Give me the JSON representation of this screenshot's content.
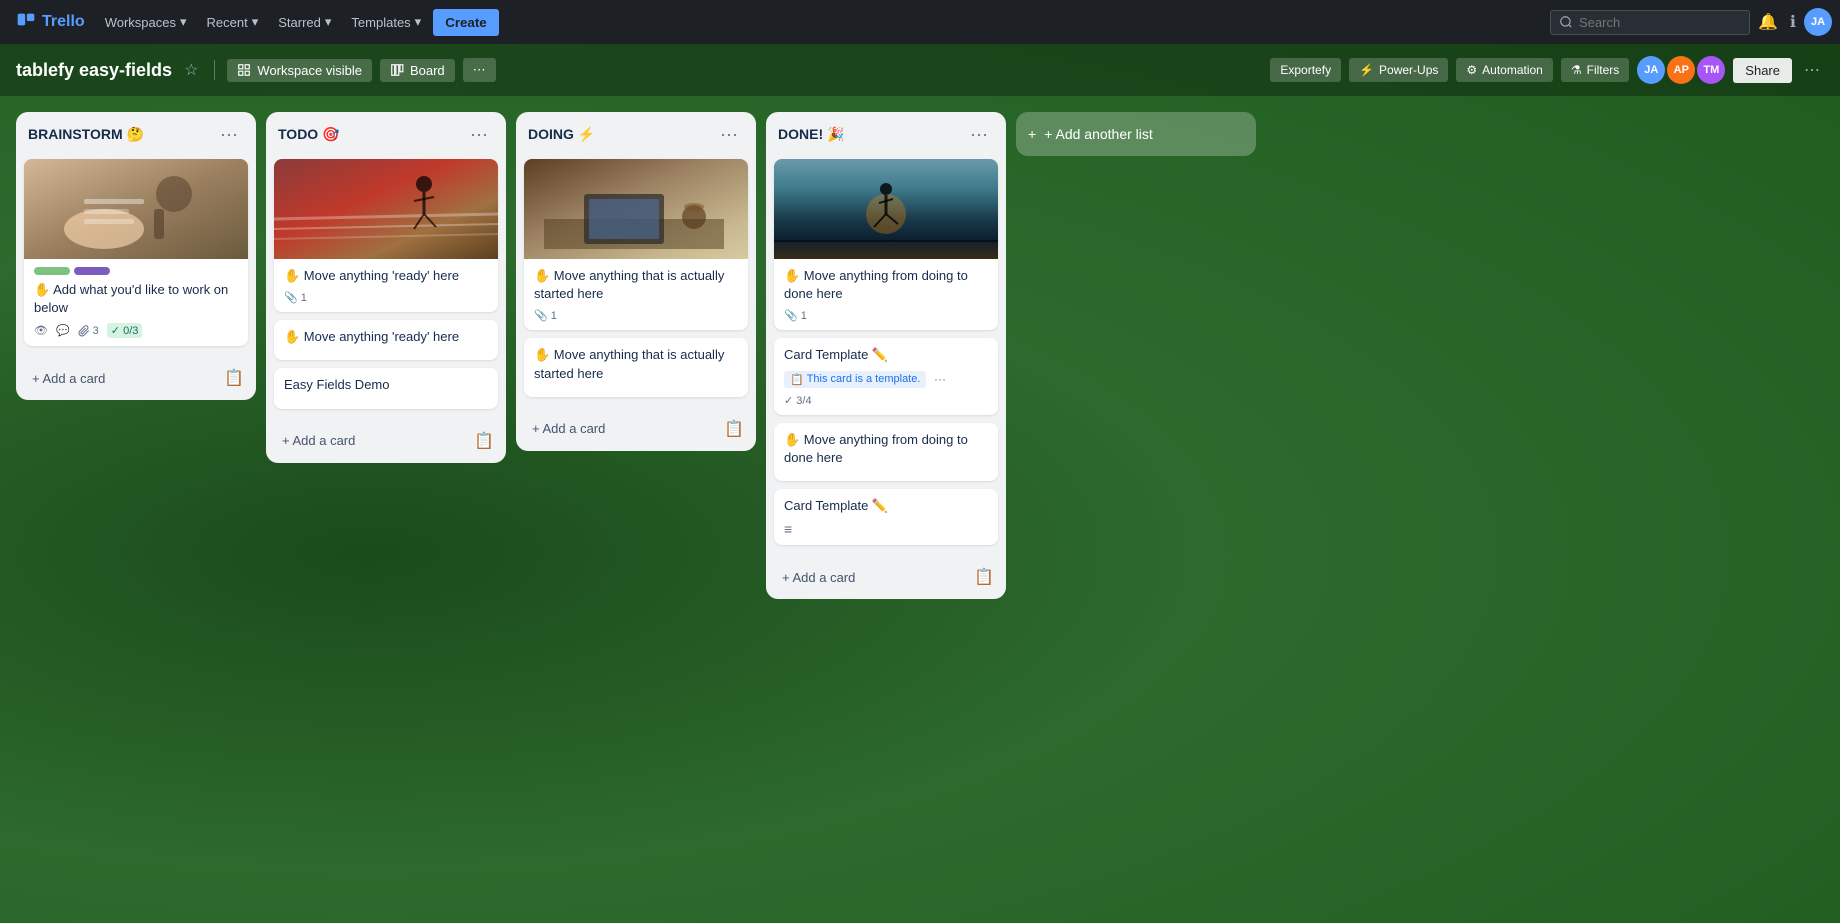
{
  "app": {
    "logo_text": "Trello"
  },
  "topnav": {
    "workspaces_label": "Workspaces",
    "recent_label": "Recent",
    "starred_label": "Starred",
    "templates_label": "Templates",
    "create_label": "Create",
    "search_placeholder": "Search",
    "chevron": "▾"
  },
  "boardheader": {
    "title": "tablefy easy-fields",
    "star_symbol": "☆",
    "workspace_visible_label": "Workspace visible",
    "board_label": "Board",
    "customize_symbol": "⋯",
    "exportefy_label": "Exportefy",
    "powerups_label": "Power-Ups",
    "automation_label": "Automation",
    "filters_label": "Filters",
    "share_label": "Share"
  },
  "lists": [
    {
      "id": "brainstorm",
      "title": "BRAINSTORM 🤔",
      "cards": [
        {
          "id": "b1",
          "has_image": true,
          "image_desc": "hands writing on paper",
          "image_gradient": "linear-gradient(135deg, #c4a882 0%, #8b7355 50%, #6b5a3e 100%)",
          "labels": [
            {
              "color": "#7bc47f",
              "width": 36
            },
            {
              "color": "#7c5cbf",
              "width": 36
            }
          ],
          "text": "✋ Add what you'd like to work on below",
          "badges": [
            {
              "type": "watch",
              "symbol": "👁",
              "count": ""
            },
            {
              "type": "comment",
              "symbol": "💬",
              "count": ""
            },
            {
              "type": "attach",
              "symbol": "📎",
              "count": "3"
            },
            {
              "type": "checklist",
              "symbol": "✓",
              "count": "0/3",
              "highlight": true
            }
          ]
        }
      ],
      "add_card_label": "+ Add a card"
    },
    {
      "id": "todo",
      "title": "TODO 🎯",
      "cards": [
        {
          "id": "t1",
          "has_image": true,
          "image_desc": "running on track",
          "image_gradient": "linear-gradient(135deg, #8b3a3a 0%, #c0392b 30%, #8b5a2b 60%, #5a4020 100%)",
          "text": "✋ Move anything 'ready' here",
          "badges": [
            {
              "type": "attach",
              "symbol": "📎",
              "count": "1"
            }
          ]
        },
        {
          "id": "t2",
          "text": "✋ Move anything 'ready' here",
          "badges": []
        },
        {
          "id": "t3",
          "text": "Easy Fields Demo",
          "badges": []
        }
      ],
      "add_card_label": "+ Add a card"
    },
    {
      "id": "doing",
      "title": "DOING ⚡",
      "cards": [
        {
          "id": "d1",
          "has_image": true,
          "image_desc": "laptop on desk with coffee",
          "image_gradient": "linear-gradient(135deg, #4a3728 0%, #7a6550 30%, #b8a882 60%, #d4c4a0 100%)",
          "text": "✋ Move anything that is actually started here",
          "badges": [
            {
              "type": "attach",
              "symbol": "📎",
              "count": "1"
            }
          ]
        },
        {
          "id": "d2",
          "text": "✋ Move anything that is actually started here",
          "badges": []
        }
      ],
      "add_card_label": "+ Add a card"
    },
    {
      "id": "done",
      "title": "DONE! 🎉",
      "cards": [
        {
          "id": "dn1",
          "has_image": true,
          "image_desc": "person jumping at sunset",
          "image_gradient": "linear-gradient(180deg, #4a7a8a 0%, #2d5a6e 30%, #1a3a4a 60%, #0d1f2a 80%, #3a2a1a 100%)",
          "text": "✋ Move anything from doing to done here",
          "badges": [
            {
              "type": "attach",
              "symbol": "📎",
              "count": "1"
            }
          ]
        },
        {
          "id": "dn2",
          "text": "Card Template ✏️",
          "is_template": true,
          "template_badge": "This card is a template.",
          "badges": [
            {
              "type": "checklist",
              "symbol": "✓",
              "count": "3/4",
              "highlight": false
            }
          ]
        },
        {
          "id": "dn3",
          "text": "✋ Move anything from doing to done here",
          "badges": []
        },
        {
          "id": "dn4",
          "text": "Card Template ✏️",
          "is_template2": true,
          "badges": [
            {
              "type": "desc",
              "symbol": "≡",
              "count": ""
            }
          ]
        }
      ],
      "add_card_label": "+ Add a card"
    }
  ],
  "add_list_label": "+ Add another list",
  "avatars": [
    {
      "initials": "JA",
      "color": "#579dff"
    },
    {
      "initials": "AP",
      "color": "#f97316"
    },
    {
      "initials": "TM",
      "color": "#a855f7"
    }
  ]
}
